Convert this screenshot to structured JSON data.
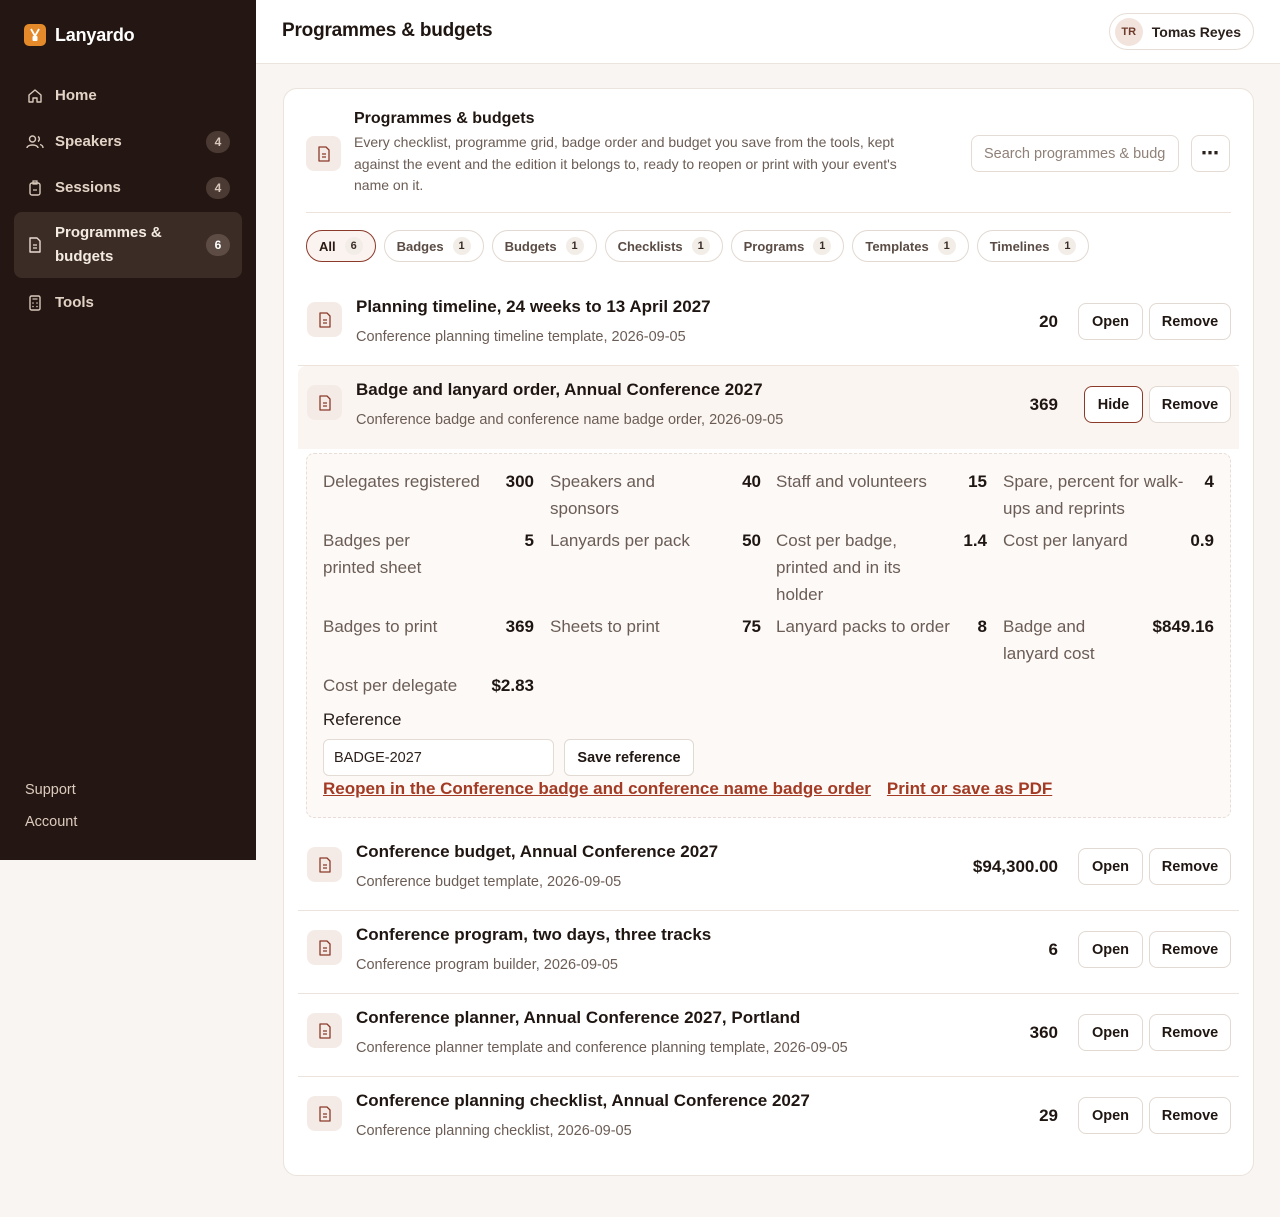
{
  "brand": {
    "name": "Lanyardo",
    "icon": "lanyard-icon",
    "accent": "#e48a2a"
  },
  "sidebar": {
    "items": [
      {
        "label": "Home",
        "icon": "home-icon"
      },
      {
        "label": "Speakers",
        "icon": "users-icon",
        "badge": "4"
      },
      {
        "label": "Sessions",
        "icon": "badge-icon",
        "badge": "4"
      },
      {
        "label": "Programmes & budgets",
        "icon": "document-icon",
        "badge": "6",
        "active": true
      },
      {
        "label": "Tools",
        "icon": "calculator-icon"
      }
    ],
    "bottom": {
      "support": "Support",
      "account": "Account"
    }
  },
  "topbar": {
    "title": "Programmes & budgets",
    "user": {
      "initials": "TR",
      "name": "Tomas Reyes"
    }
  },
  "card": {
    "title": "Programmes & budgets",
    "description": "Every checklist, programme grid, badge order and budget you save from the tools, kept against the event and the edition it belongs to, ready to reopen or print with your event's name on it.",
    "search_placeholder": "Search programmes & budgets",
    "more": "⋯"
  },
  "filters": [
    {
      "label": "All",
      "count": "6",
      "active": true
    },
    {
      "label": "Badges",
      "count": "1"
    },
    {
      "label": "Budgets",
      "count": "1"
    },
    {
      "label": "Checklists",
      "count": "1"
    },
    {
      "label": "Programs",
      "count": "1"
    },
    {
      "label": "Templates",
      "count": "1"
    },
    {
      "label": "Timelines",
      "count": "1"
    }
  ],
  "buttons": {
    "open": "Open",
    "hide": "Hide",
    "remove": "Remove"
  },
  "rows": [
    {
      "title": "Planning timeline, 24 weeks to 13 April 2027",
      "subtitle": "Conference planning timeline template, 2026-09-05",
      "value": "20"
    },
    {
      "title": "Badge and lanyard order, Annual Conference 2027",
      "subtitle": "Conference badge and conference name badge order, 2026-09-05",
      "value": "369",
      "expanded": true
    },
    {
      "title": "Conference budget, Annual Conference 2027",
      "subtitle": "Conference budget template, 2026-09-05",
      "value": "$94,300.00"
    },
    {
      "title": "Conference program, two days, three tracks",
      "subtitle": "Conference program builder, 2026-09-05",
      "value": "6"
    },
    {
      "title": "Conference planner, Annual Conference 2027, Portland",
      "subtitle": "Conference planner template and conference planning template, 2026-09-05",
      "value": "360"
    },
    {
      "title": "Conference planning checklist, Annual Conference 2027",
      "subtitle": "Conference planning checklist, 2026-09-05",
      "value": "29"
    }
  ],
  "detail": {
    "fields": [
      {
        "label": "Delegates registered",
        "value": "300"
      },
      {
        "label": "Speakers and sponsors",
        "value": "40"
      },
      {
        "label": "Staff and volunteers",
        "value": "15"
      },
      {
        "label": "Spare, percent for walk-ups and reprints",
        "value": "4"
      },
      {
        "label": "Badges per printed sheet",
        "value": "5"
      },
      {
        "label": "Lanyards per pack",
        "value": "50"
      },
      {
        "label": "Cost per badge, printed and in its holder",
        "value": "1.4"
      },
      {
        "label": "Cost per lanyard",
        "value": "0.9"
      },
      {
        "label": "Badges to print",
        "value": "369"
      },
      {
        "label": "Sheets to print",
        "value": "75"
      },
      {
        "label": "Lanyard packs to order",
        "value": "8"
      },
      {
        "label": "Badge and lanyard cost",
        "value": "$849.16"
      },
      {
        "label": "Cost per delegate",
        "value": "$2.83"
      }
    ],
    "reference_label": "Reference",
    "reference_value": "BADGE-2027",
    "save_reference": "Save reference",
    "reopen_link": "Reopen in the Conference badge and conference name badge order",
    "print_link": "Print or save as PDF"
  }
}
